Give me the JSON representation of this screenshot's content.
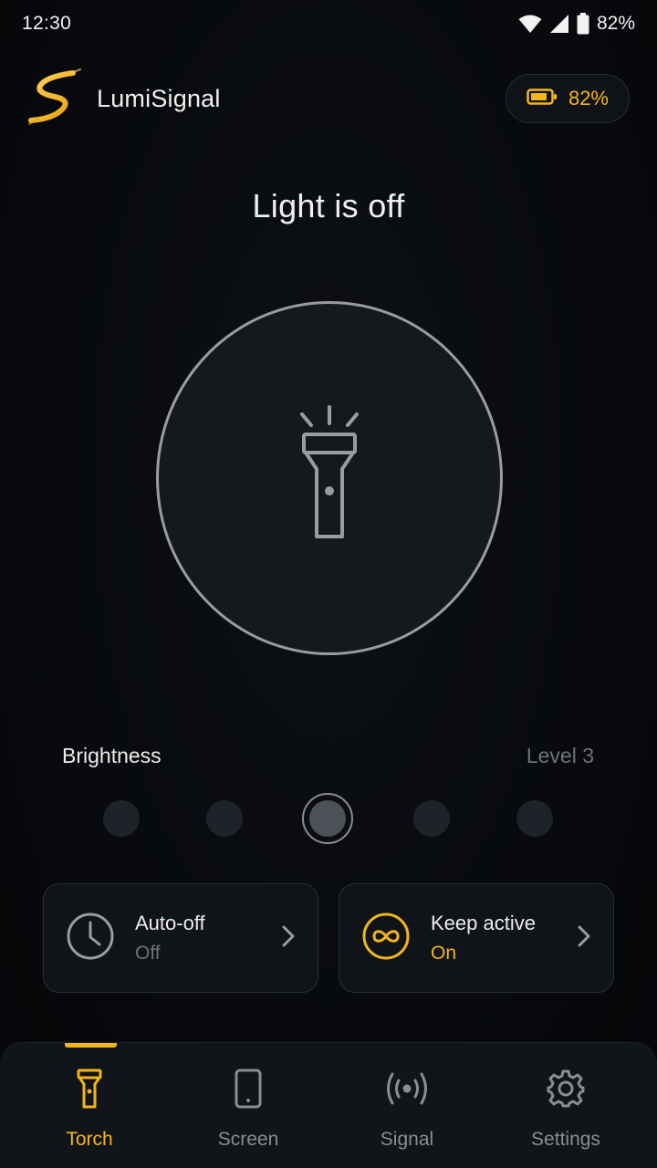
{
  "status_bar": {
    "time": "12:30",
    "battery": "82%"
  },
  "header": {
    "app_name": "LumiSignal",
    "battery": "82%"
  },
  "light_status": "Light is off",
  "brightness": {
    "label": "Brightness",
    "level_text": "Level 3",
    "selected_level": 3,
    "levels": 5
  },
  "cards": [
    {
      "title": "Auto-off",
      "value": "Off",
      "icon": "clock-icon"
    },
    {
      "title": "Keep active",
      "value": "On",
      "icon": "infinity-icon"
    }
  ],
  "nav": [
    {
      "label": "Torch",
      "icon": "flashlight-icon",
      "active": true
    },
    {
      "label": "Screen",
      "icon": "phone-icon",
      "active": false
    },
    {
      "label": "Signal",
      "icon": "broadcast-icon",
      "active": false
    },
    {
      "label": "Settings",
      "icon": "gear-icon",
      "active": false
    }
  ],
  "colors": {
    "accent": "#f2b61a",
    "background": "#07090c",
    "muted": "#8a8d92"
  }
}
